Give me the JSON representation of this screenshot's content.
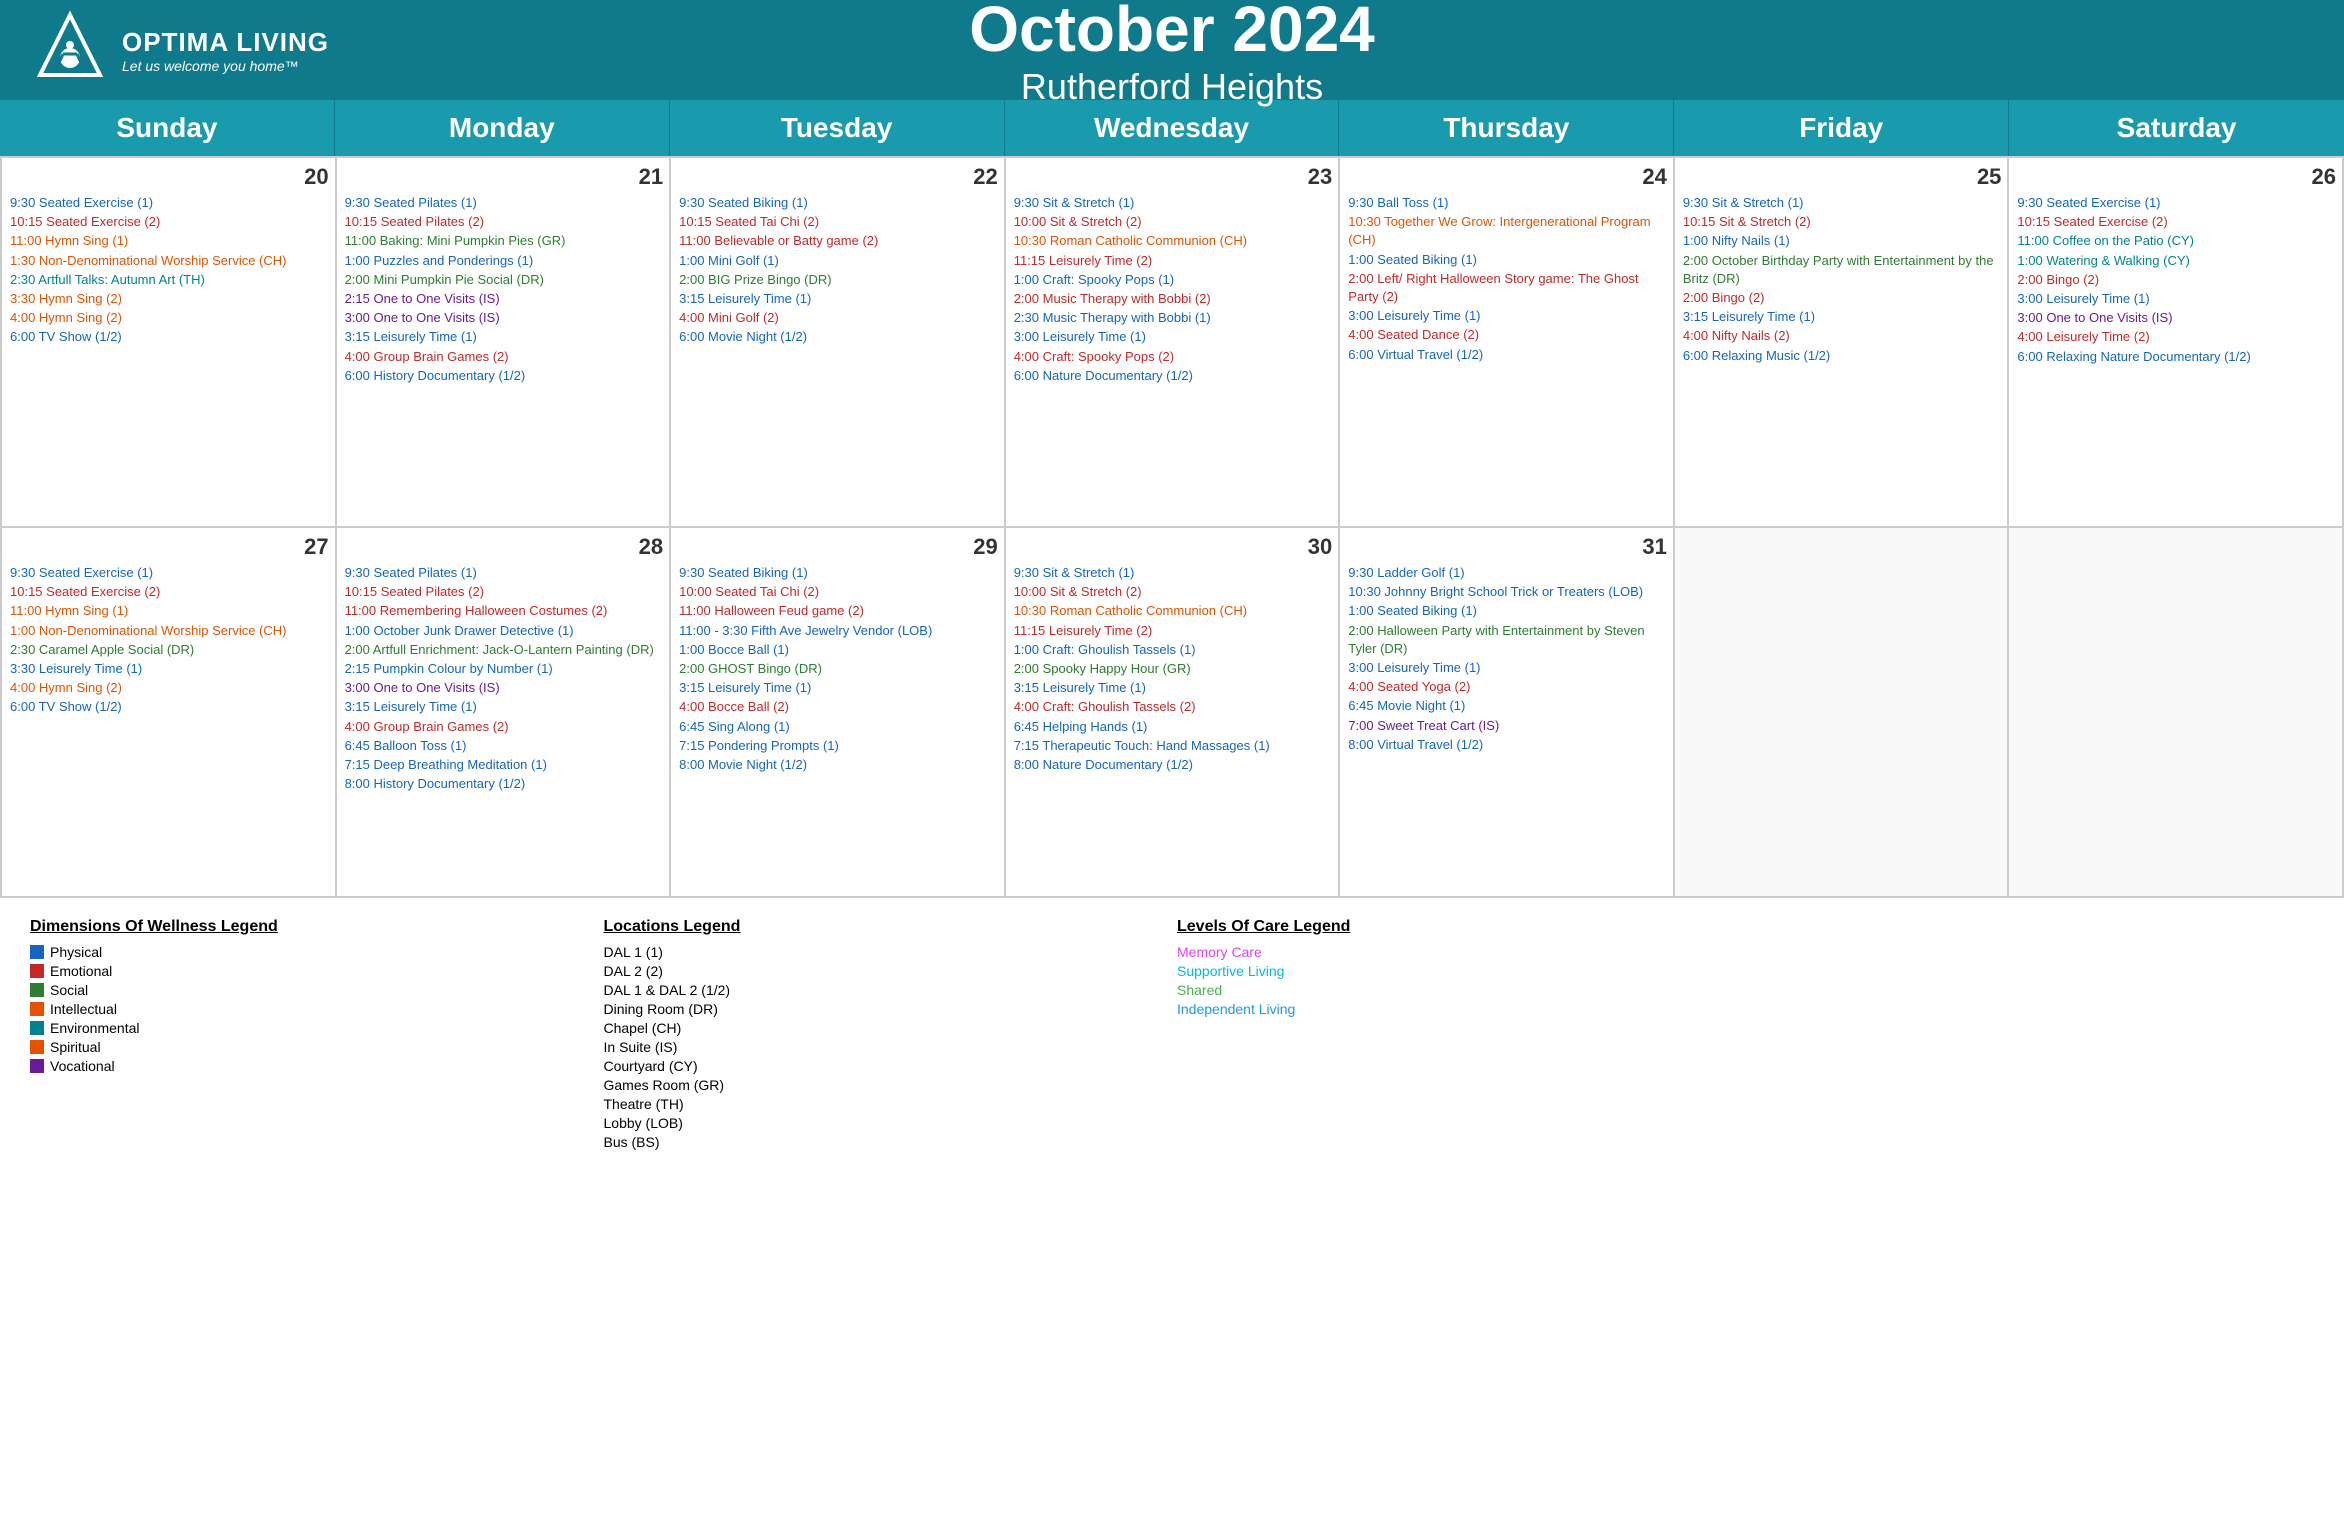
{
  "header": {
    "brand": "OPTIMA LIVING",
    "tagline": "Let us welcome you home™",
    "month_year": "October 2024",
    "location": "Rutherford Heights"
  },
  "days": [
    "Sunday",
    "Monday",
    "Tuesday",
    "Wednesday",
    "Thursday",
    "Friday",
    "Saturday"
  ],
  "weeks": [
    {
      "cells": [
        {
          "date": 20,
          "events": [
            {
              "text": "9:30 Seated Exercise (1)",
              "color": "blue"
            },
            {
              "text": "10:15 Seated Exercise (2)",
              "color": "red"
            },
            {
              "text": "11:00 Hymn Sing (1)",
              "color": "orange"
            },
            {
              "text": "1:30 Non-Denominational Worship Service (CH)",
              "color": "orange"
            },
            {
              "text": "2:30 Artfull Talks: Autumn Art (TH)",
              "color": "teal"
            },
            {
              "text": "3:30 Hymn Sing (2)",
              "color": "orange"
            },
            {
              "text": "4:00 Hymn Sing (2)",
              "color": "orange"
            },
            {
              "text": "6:00 TV Show (1/2)",
              "color": "blue"
            }
          ]
        },
        {
          "date": 21,
          "events": [
            {
              "text": "9:30 Seated Pilates (1)",
              "color": "blue"
            },
            {
              "text": "10:15 Seated Pilates (2)",
              "color": "red"
            },
            {
              "text": "11:00 Baking: Mini Pumpkin Pies (GR)",
              "color": "green"
            },
            {
              "text": "1:00 Puzzles and Ponderings (1)",
              "color": "blue"
            },
            {
              "text": "2:00 Mini Pumpkin Pie Social (DR)",
              "color": "green"
            },
            {
              "text": "2:15 One to One Visits (IS)",
              "color": "purple"
            },
            {
              "text": "3:00 One to One Visits (IS)",
              "color": "purple"
            },
            {
              "text": "3:15 Leisurely Time (1)",
              "color": "blue"
            },
            {
              "text": "4:00 Group Brain Games (2)",
              "color": "red"
            },
            {
              "text": "6:00 History Documentary (1/2)",
              "color": "blue"
            }
          ]
        },
        {
          "date": 22,
          "events": [
            {
              "text": "9:30 Seated Biking (1)",
              "color": "blue"
            },
            {
              "text": "10:15 Seated Tai Chi (2)",
              "color": "red"
            },
            {
              "text": "11:00 Believable or Batty game (2)",
              "color": "red"
            },
            {
              "text": "1:00 Mini Golf (1)",
              "color": "blue"
            },
            {
              "text": "2:00 BIG Prize Bingo (DR)",
              "color": "green"
            },
            {
              "text": "3:15 Leisurely Time (1)",
              "color": "blue"
            },
            {
              "text": "4:00 Mini Golf (2)",
              "color": "red"
            },
            {
              "text": "6:00 Movie Night (1/2)",
              "color": "blue"
            }
          ]
        },
        {
          "date": 23,
          "events": [
            {
              "text": "9:30 Sit & Stretch (1)",
              "color": "blue"
            },
            {
              "text": "10:00 Sit & Stretch (2)",
              "color": "red"
            },
            {
              "text": "10:30 Roman Catholic Communion (CH)",
              "color": "orange"
            },
            {
              "text": "11:15 Leisurely Time (2)",
              "color": "red"
            },
            {
              "text": "1:00 Craft: Spooky Pops (1)",
              "color": "blue"
            },
            {
              "text": "2:00 Music Therapy with Bobbi (2)",
              "color": "red"
            },
            {
              "text": "2:30 Music Therapy with Bobbi (1)",
              "color": "blue"
            },
            {
              "text": "3:00 Leisurely Time (1)",
              "color": "blue"
            },
            {
              "text": "4:00 Craft: Spooky Pops (2)",
              "color": "red"
            },
            {
              "text": "6:00 Nature Documentary (1/2)",
              "color": "blue"
            }
          ]
        },
        {
          "date": 24,
          "events": [
            {
              "text": "9:30 Ball Toss (1)",
              "color": "blue"
            },
            {
              "text": "10:30 Together We Grow: Intergenerational Program (CH)",
              "color": "orange"
            },
            {
              "text": "1:00 Seated Biking (1)",
              "color": "blue"
            },
            {
              "text": "2:00 Left/ Right Halloween Story game: The Ghost Party (2)",
              "color": "red"
            },
            {
              "text": "3:00 Leisurely Time (1)",
              "color": "blue"
            },
            {
              "text": "4:00 Seated Dance (2)",
              "color": "red"
            },
            {
              "text": "6:00 Virtual Travel (1/2)",
              "color": "blue"
            }
          ]
        },
        {
          "date": 25,
          "events": [
            {
              "text": "9:30 Sit & Stretch (1)",
              "color": "blue"
            },
            {
              "text": "10:15 Sit & Stretch (2)",
              "color": "red"
            },
            {
              "text": "1:00 Nifty Nails (1)",
              "color": "blue"
            },
            {
              "text": "2:00 October Birthday Party with Entertainment by the Britz (DR)",
              "color": "green"
            },
            {
              "text": "2:00 Bingo (2)",
              "color": "red"
            },
            {
              "text": "3:15 Leisurely Time (1)",
              "color": "blue"
            },
            {
              "text": "4:00 Nifty Nails (2)",
              "color": "red"
            },
            {
              "text": "6:00 Relaxing Music (1/2)",
              "color": "blue"
            }
          ]
        },
        {
          "date": 26,
          "events": [
            {
              "text": "9:30 Seated Exercise (1)",
              "color": "blue"
            },
            {
              "text": "10:15 Seated Exercise (2)",
              "color": "red"
            },
            {
              "text": "11:00 Coffee on the Patio (CY)",
              "color": "teal"
            },
            {
              "text": "1:00 Watering & Walking (CY)",
              "color": "teal"
            },
            {
              "text": "2:00 Bingo (2)",
              "color": "red"
            },
            {
              "text": "3:00 Leisurely Time (1)",
              "color": "blue"
            },
            {
              "text": "3:00 One to One Visits (IS)",
              "color": "purple"
            },
            {
              "text": "4:00 Leisurely Time (2)",
              "color": "red"
            },
            {
              "text": "6:00 Relaxing Nature Documentary (1/2)",
              "color": "blue"
            }
          ]
        }
      ]
    },
    {
      "cells": [
        {
          "date": 27,
          "events": [
            {
              "text": "9:30 Seated Exercise (1)",
              "color": "blue"
            },
            {
              "text": "10:15 Seated Exercise (2)",
              "color": "red"
            },
            {
              "text": "11:00 Hymn Sing (1)",
              "color": "orange"
            },
            {
              "text": "1:00 Non-Denominational Worship Service (CH)",
              "color": "orange"
            },
            {
              "text": "2:30 Caramel Apple Social (DR)",
              "color": "green"
            },
            {
              "text": "3:30 Leisurely Time (1)",
              "color": "blue"
            },
            {
              "text": "4:00 Hymn Sing (2)",
              "color": "orange"
            },
            {
              "text": "6:00 TV Show (1/2)",
              "color": "blue"
            }
          ]
        },
        {
          "date": 28,
          "events": [
            {
              "text": "9:30 Seated Pilates (1)",
              "color": "blue"
            },
            {
              "text": "10:15 Seated Pilates (2)",
              "color": "red"
            },
            {
              "text": "11:00 Remembering Halloween Costumes (2)",
              "color": "red"
            },
            {
              "text": "1:00 October Junk Drawer Detective (1)",
              "color": "blue"
            },
            {
              "text": "2:00 Artfull Enrichment: Jack-O-Lantern Painting (DR)",
              "color": "green"
            },
            {
              "text": "2:15 Pumpkin Colour by Number (1)",
              "color": "blue"
            },
            {
              "text": "3:00 One to One Visits (IS)",
              "color": "purple"
            },
            {
              "text": "3:15 Leisurely Time (1)",
              "color": "blue"
            },
            {
              "text": "4:00 Group Brain Games (2)",
              "color": "red"
            },
            {
              "text": "6:45 Balloon Toss (1)",
              "color": "blue"
            },
            {
              "text": "7:15 Deep Breathing Meditation (1)",
              "color": "blue"
            },
            {
              "text": "8:00 History Documentary (1/2)",
              "color": "blue"
            }
          ]
        },
        {
          "date": 29,
          "events": [
            {
              "text": "9:30 Seated Biking (1)",
              "color": "blue"
            },
            {
              "text": "10:00 Seated Tai Chi (2)",
              "color": "red"
            },
            {
              "text": "11:00 Halloween Feud game (2)",
              "color": "red"
            },
            {
              "text": "11:00 - 3:30 Fifth Ave Jewelry Vendor (LOB)",
              "color": "blue"
            },
            {
              "text": "1:00 Bocce Ball (1)",
              "color": "blue"
            },
            {
              "text": "2:00 GHOST Bingo (DR)",
              "color": "green"
            },
            {
              "text": "3:15 Leisurely Time (1)",
              "color": "blue"
            },
            {
              "text": "4:00 Bocce Ball (2)",
              "color": "red"
            },
            {
              "text": "6:45 Sing Along (1)",
              "color": "blue"
            },
            {
              "text": "7:15 Pondering Prompts (1)",
              "color": "blue"
            },
            {
              "text": "8:00 Movie Night (1/2)",
              "color": "blue"
            }
          ]
        },
        {
          "date": 30,
          "events": [
            {
              "text": "9:30 Sit & Stretch (1)",
              "color": "blue"
            },
            {
              "text": "10:00 Sit & Stretch (2)",
              "color": "red"
            },
            {
              "text": "10:30 Roman Catholic Communion (CH)",
              "color": "orange"
            },
            {
              "text": "11:15 Leisurely Time (2)",
              "color": "red"
            },
            {
              "text": "1:00 Craft: Ghoulish Tassels (1)",
              "color": "blue"
            },
            {
              "text": "2:00 Spooky Happy Hour (GR)",
              "color": "green"
            },
            {
              "text": "3:15 Leisurely Time (1)",
              "color": "blue"
            },
            {
              "text": "4:00 Craft: Ghoulish Tassels (2)",
              "color": "red"
            },
            {
              "text": "6:45 Helping Hands (1)",
              "color": "blue"
            },
            {
              "text": "7:15 Therapeutic Touch: Hand Massages (1)",
              "color": "blue"
            },
            {
              "text": "8:00 Nature Documentary (1/2)",
              "color": "blue"
            }
          ]
        },
        {
          "date": 31,
          "events": [
            {
              "text": "9:30 Ladder Golf (1)",
              "color": "blue"
            },
            {
              "text": "10:30 Johnny Bright School Trick or Treaters (LOB)",
              "color": "blue"
            },
            {
              "text": "1:00 Seated Biking (1)",
              "color": "blue"
            },
            {
              "text": "2:00 Halloween Party with Entertainment by Steven Tyler (DR)",
              "color": "green"
            },
            {
              "text": "3:00 Leisurely Time (1)",
              "color": "blue"
            },
            {
              "text": "4:00 Seated Yoga (2)",
              "color": "red"
            },
            {
              "text": "6:45 Movie Night (1)",
              "color": "blue"
            },
            {
              "text": "7:00 Sweet Treat Cart (IS)",
              "color": "purple"
            },
            {
              "text": "8:00 Virtual Travel (1/2)",
              "color": "blue"
            }
          ]
        },
        {
          "date": null,
          "events": []
        },
        {
          "date": null,
          "events": []
        }
      ]
    }
  ],
  "legend": {
    "wellness_title": "Dimensions Of Wellness Legend",
    "wellness_items": [
      {
        "label": "Physical",
        "color": "#1565c0"
      },
      {
        "label": "Emotional",
        "color": "#c62828"
      },
      {
        "label": "Social",
        "color": "#2e7d32"
      },
      {
        "label": "Intellectual",
        "color": "#e65100"
      },
      {
        "label": "Environmental",
        "color": "#00838f"
      },
      {
        "label": "Spiritual",
        "color": "#e65100"
      },
      {
        "label": "Vocational",
        "color": "#6a1b9a"
      }
    ],
    "locations_title": "Locations Legend",
    "locations": [
      "DAL 1 (1)",
      "DAL 2 (2)",
      "DAL 1 & DAL 2 (1/2)",
      "Dining Room (DR)",
      "Chapel (CH)",
      "In Suite (IS)",
      "Courtyard (CY)",
      "Games Room (GR)",
      "Theatre (TH)",
      "Lobby (LOB)",
      "Bus (BS)"
    ],
    "care_title": "Levels Of Care Legend",
    "care_items": [
      {
        "label": "Memory Care",
        "color": "#e040fb"
      },
      {
        "label": "Supportive Living",
        "color": "#00bcd4"
      },
      {
        "label": "Shared",
        "color": "#4caf50"
      },
      {
        "label": "Independent Living",
        "color": "#2196f3"
      }
    ]
  }
}
